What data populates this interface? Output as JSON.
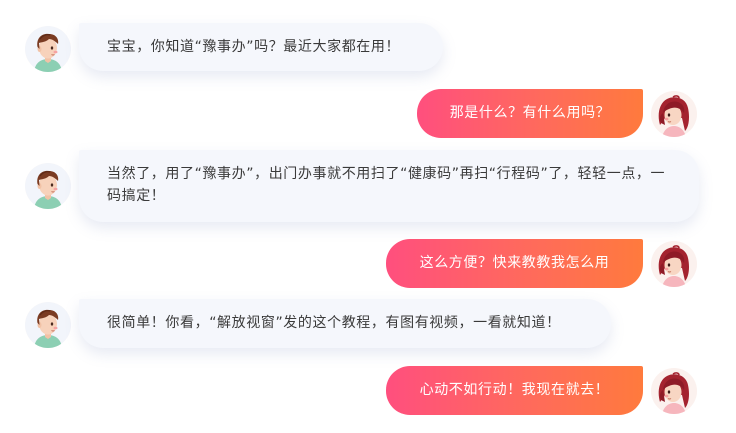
{
  "conversation": {
    "messages": [
      {
        "sender": "boy",
        "text": "宝宝，你知道“豫事办”吗？最近大家都在用！"
      },
      {
        "sender": "girl",
        "text": "那是什么？有什么用吗？"
      },
      {
        "sender": "boy",
        "text": "当然了，用了“豫事办”，出门办事就不用扫了“健康码”再扫“行程码”了，轻轻一点，一码搞定！"
      },
      {
        "sender": "girl",
        "text": "这么方便？快来教教我怎么用"
      },
      {
        "sender": "boy",
        "text": "很简单！你看，“解放视窗”发的这个教程，有图有视频，一看就知道！"
      },
      {
        "sender": "girl",
        "text": "心动不如行动！我现在就去！"
      }
    ]
  },
  "theme": {
    "left_bubble_bg": "#f5f7fc",
    "right_bubble_gradient": [
      "#ff4f7e",
      "#ff7a3d"
    ],
    "text_dark": "#3a3a3a",
    "text_light": "#ffffff"
  },
  "icons": {
    "boy": "boy-avatar-icon",
    "girl": "girl-avatar-icon"
  }
}
